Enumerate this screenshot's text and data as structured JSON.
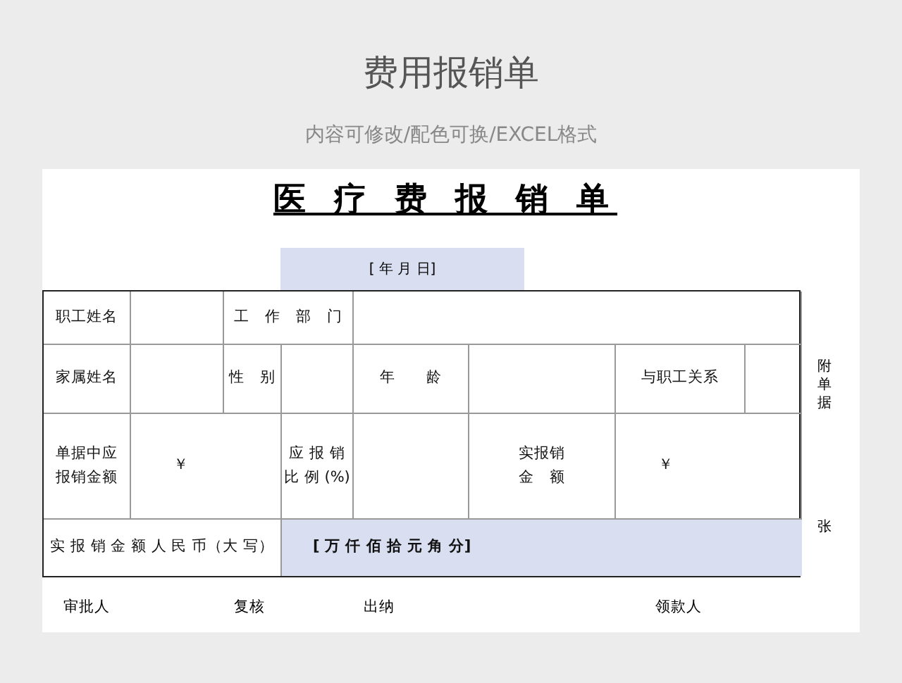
{
  "header": {
    "title": "费用报销单",
    "subtitle": "内容可修改/配色可换/EXCEL格式"
  },
  "form": {
    "title": "医 疗 费 报 销 单",
    "date_field": "[ 年 月 日]",
    "rows": [
      [
        {
          "kind": "label",
          "lines": [
            "职工姓名"
          ]
        },
        {
          "kind": "blank"
        },
        {
          "kind": "label",
          "lines": [
            "工　作　部　门"
          ]
        },
        {
          "kind": "blank"
        }
      ],
      [
        {
          "kind": "label",
          "lines": [
            "家属姓名"
          ]
        },
        {
          "kind": "blank"
        },
        {
          "kind": "label",
          "lines": [
            "性　别"
          ]
        },
        {
          "kind": "blank"
        },
        {
          "kind": "label",
          "lines": [
            "年　　龄"
          ]
        },
        {
          "kind": "blank"
        },
        {
          "kind": "label",
          "lines": [
            "与职工关系"
          ]
        },
        {
          "kind": "blank"
        }
      ],
      [
        {
          "kind": "label",
          "lines": [
            "单据中应",
            "报销金额"
          ]
        },
        {
          "kind": "value",
          "lines": [
            "￥"
          ]
        },
        {
          "kind": "label",
          "lines": [
            "应 报 销",
            "比 例 (%)"
          ]
        },
        {
          "kind": "blank"
        },
        {
          "kind": "label",
          "lines": [
            "实报销",
            "金　额"
          ]
        },
        {
          "kind": "value",
          "lines": [
            "￥"
          ]
        }
      ],
      [
        {
          "kind": "label",
          "lines": [
            "实 报 销 金 额 人 民 币（大 写）"
          ]
        },
        {
          "kind": "highlight",
          "lines": [
            "[ 万 仟 佰 拾 元 角 分]"
          ]
        }
      ]
    ],
    "side_notes": [
      "附单据",
      "张"
    ],
    "signatures": [
      "审批人",
      "复核",
      "出纳",
      "领款人"
    ]
  }
}
